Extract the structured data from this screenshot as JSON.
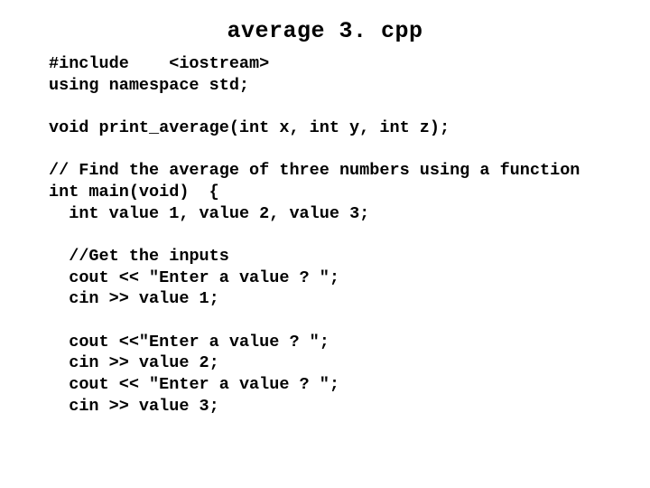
{
  "title": "average 3. cpp",
  "lines": [
    "#include    <iostream>",
    "using namespace std;",
    "",
    "void print_average(int x, int y, int z);",
    "",
    "// Find the average of three numbers using a function",
    "int main(void)  {",
    "  int value 1, value 2, value 3;",
    "",
    "  //Get the inputs",
    "  cout << \"Enter a value ? \";",
    "  cin >> value 1;",
    "",
    "  cout <<\"Enter a value ? \";",
    "  cin >> value 2;",
    "  cout << \"Enter a value ? \";",
    "  cin >> value 3;"
  ]
}
